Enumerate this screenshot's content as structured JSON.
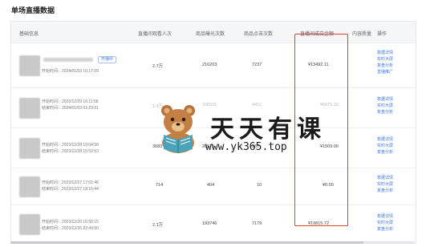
{
  "page_title": "单场直播数据",
  "columns": [
    "基础信息",
    "直播间观看人次",
    "商品曝光次数",
    "商品点击次数",
    "直播间成交金额",
    "内容质量",
    "操作"
  ],
  "live_tag": "开播中",
  "rows": [
    {
      "start": "开始时间：2024/01/03 16:17:09",
      "end": "",
      "viewers": "2.7万",
      "exposures": "216203",
      "clicks": "7237",
      "amount": "¥13492.11"
    },
    {
      "start": "开始时间：2023/12/29 16:11:58",
      "end": "结束时间：2024/01/03 01:23:31",
      "viewers": "1.4万",
      "exposures": "106521",
      "clicks": "4411",
      "amount": "¥6875.12"
    },
    {
      "start": "开始时间：2023/12/28 19:04:58",
      "end": "结束时间：2023/12/28 15:52:53",
      "viewers": "3683",
      "exposures": "28575",
      "clicks": "967",
      "amount": "¥1509.00"
    },
    {
      "start": "开始时间：2023/12/27 17:01:46",
      "end": "结束时间：2023/12/27 18:15:44",
      "viewers": "714",
      "exposures": "404",
      "clicks": "10",
      "amount": "¥0.00"
    },
    {
      "start": "开始时间：2023/12/20 16:50:15",
      "end": "结束时间：2023/12/26 22:43:50",
      "viewers": "2.1万",
      "exposures": "193746",
      "clicks": "7179",
      "amount": "¥19815.72"
    }
  ],
  "ops_first": [
    "数据详情",
    "实时大屏",
    "复盘分析",
    "直播推广"
  ],
  "ops": [
    "数据详情",
    "实时大屏",
    "复盘分析"
  ],
  "watermark": {
    "text": "天天有课",
    "url": "www.yk365.top"
  },
  "colors": {
    "highlight": "#e03b3b",
    "link": "#3d7bf5"
  }
}
